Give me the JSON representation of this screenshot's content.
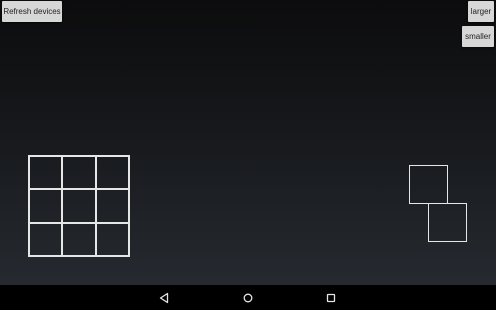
{
  "toolbar": {
    "refresh_label": "Refresh devices",
    "larger_label": "larger",
    "smaller_label": "smaller"
  },
  "grid": {
    "rows": 3,
    "cols": 3
  },
  "colors": {
    "button_bg": "#d7d7d7",
    "outline": "#e6e6e6",
    "background_top": "#0c0c0d",
    "background_bottom": "#262a30",
    "nav_bar": "#000000"
  },
  "navigation": {
    "icons": [
      "back-icon",
      "home-icon",
      "recent-apps-icon"
    ]
  }
}
